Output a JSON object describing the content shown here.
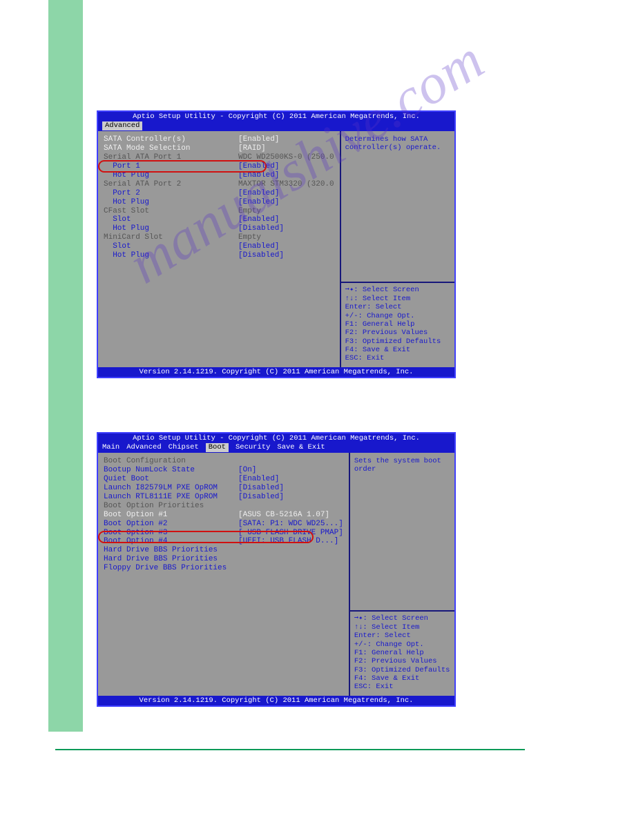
{
  "watermark": "manualshive.com",
  "bios1": {
    "title": "Aptio Setup Utility - Copyright (C) 2011 American Megatrends, Inc.",
    "tab_active": "Advanced",
    "rows": [
      {
        "label": "SATA Controller(s)",
        "value": "[Enabled]",
        "style": "white",
        "sub": false
      },
      {
        "label": "SATA Mode Selection",
        "value": "[RAID]",
        "style": "white",
        "sub": false
      },
      {
        "label": "",
        "value": "",
        "style": "",
        "sub": false
      },
      {
        "label": "Serial ATA Port 1",
        "value": "WDC WD2500KS-0 (250.0",
        "style": "gray",
        "sub": false
      },
      {
        "label": "Port 1",
        "value": "[Enabled]",
        "style": "blue",
        "sub": true
      },
      {
        "label": "Hot Plug",
        "value": "[Enabled]",
        "style": "blue",
        "sub": true
      },
      {
        "label": "Serial ATA Port 2",
        "value": "MAXTOR STM3320 (320.0",
        "style": "gray",
        "sub": false
      },
      {
        "label": "Port 2",
        "value": "[Enabled]",
        "style": "blue",
        "sub": true
      },
      {
        "label": "Hot Plug",
        "value": "[Enabled]",
        "style": "blue",
        "sub": true
      },
      {
        "label": "CFast Slot",
        "value": "Empty",
        "style": "gray",
        "sub": false
      },
      {
        "label": "Slot",
        "value": "[Enabled]",
        "style": "blue",
        "sub": true
      },
      {
        "label": "Hot Plug",
        "value": "[Disabled]",
        "style": "blue",
        "sub": true
      },
      {
        "label": "MiniCard Slot",
        "value": "Empty",
        "style": "gray",
        "sub": false
      },
      {
        "label": "Slot",
        "value": "[Enabled]",
        "style": "blue",
        "sub": true
      },
      {
        "label": "Hot Plug",
        "value": "[Disabled]",
        "style": "blue",
        "sub": true
      }
    ],
    "help_top": "Determines how SATA controller(s) operate.",
    "help_keys": [
      "➞✦: Select Screen",
      "↑↓: Select Item",
      "Enter: Select",
      "+/-: Change Opt.",
      "F1: General Help",
      "F2: Previous Values",
      "F3: Optimized Defaults",
      "F4: Save & Exit",
      "ESC: Exit"
    ],
    "footer": "Version 2.14.1219. Copyright (C) 2011 American Megatrends, Inc."
  },
  "bios2": {
    "title": "Aptio Setup Utility - Copyright (C) 2011 American Megatrends, Inc.",
    "tabs": [
      "Main",
      "Advanced",
      "Chipset",
      "Boot",
      "Security",
      "Save & Exit"
    ],
    "tab_active_index": 3,
    "rows": [
      {
        "label": "Boot Configuration",
        "value": "",
        "style": "gray",
        "sub": false
      },
      {
        "label": "Bootup NumLock State",
        "value": "[On]",
        "style": "blue",
        "sub": false
      },
      {
        "label": "",
        "value": "",
        "style": "",
        "sub": false
      },
      {
        "label": "Quiet Boot",
        "value": "[Enabled]",
        "style": "blue",
        "sub": false
      },
      {
        "label": "Launch I82579LM PXE OpROM",
        "value": "[Disabled]",
        "style": "blue",
        "sub": false
      },
      {
        "label": "Launch RTL8111E PXE OpROM",
        "value": "[Disabled]",
        "style": "blue",
        "sub": false
      },
      {
        "label": "",
        "value": "",
        "style": "",
        "sub": false
      },
      {
        "label": "Boot Option Priorities",
        "value": "",
        "style": "gray",
        "sub": false
      },
      {
        "label": "Boot Option #1",
        "value": "[ASUS CB-5216A 1.07]",
        "style": "white",
        "sub": false
      },
      {
        "label": "Boot Option #2",
        "value": "[SATA: P1: WDC WD25...]",
        "style": "blue",
        "sub": false
      },
      {
        "label": "Boot Option #3",
        "value": "[ USB FLASH DRIVE PMAP]",
        "style": "blue",
        "sub": false
      },
      {
        "label": "Boot Option #4",
        "value": "[UEFI:  USB FLASH D...]",
        "style": "blue",
        "sub": false
      },
      {
        "label": "",
        "value": "",
        "style": "",
        "sub": false
      },
      {
        "label": "Hard Drive BBS Priorities",
        "value": "",
        "style": "blue",
        "sub": false
      },
      {
        "label": "Hard Drive BBS Priorities",
        "value": "",
        "style": "blue",
        "sub": false
      },
      {
        "label": "Floppy Drive BBS Priorities",
        "value": "",
        "style": "blue",
        "sub": false
      }
    ],
    "help_top": "Sets the system boot order",
    "help_keys": [
      "➞✦: Select Screen",
      "↑↓: Select Item",
      "Enter: Select",
      "+/-: Change Opt.",
      "F1: General Help",
      "F2: Previous Values",
      "F3: Optimized Defaults",
      "F4: Save & Exit",
      "ESC: Exit"
    ],
    "footer": "Version 2.14.1219. Copyright (C) 2011 American Megatrends, Inc."
  }
}
